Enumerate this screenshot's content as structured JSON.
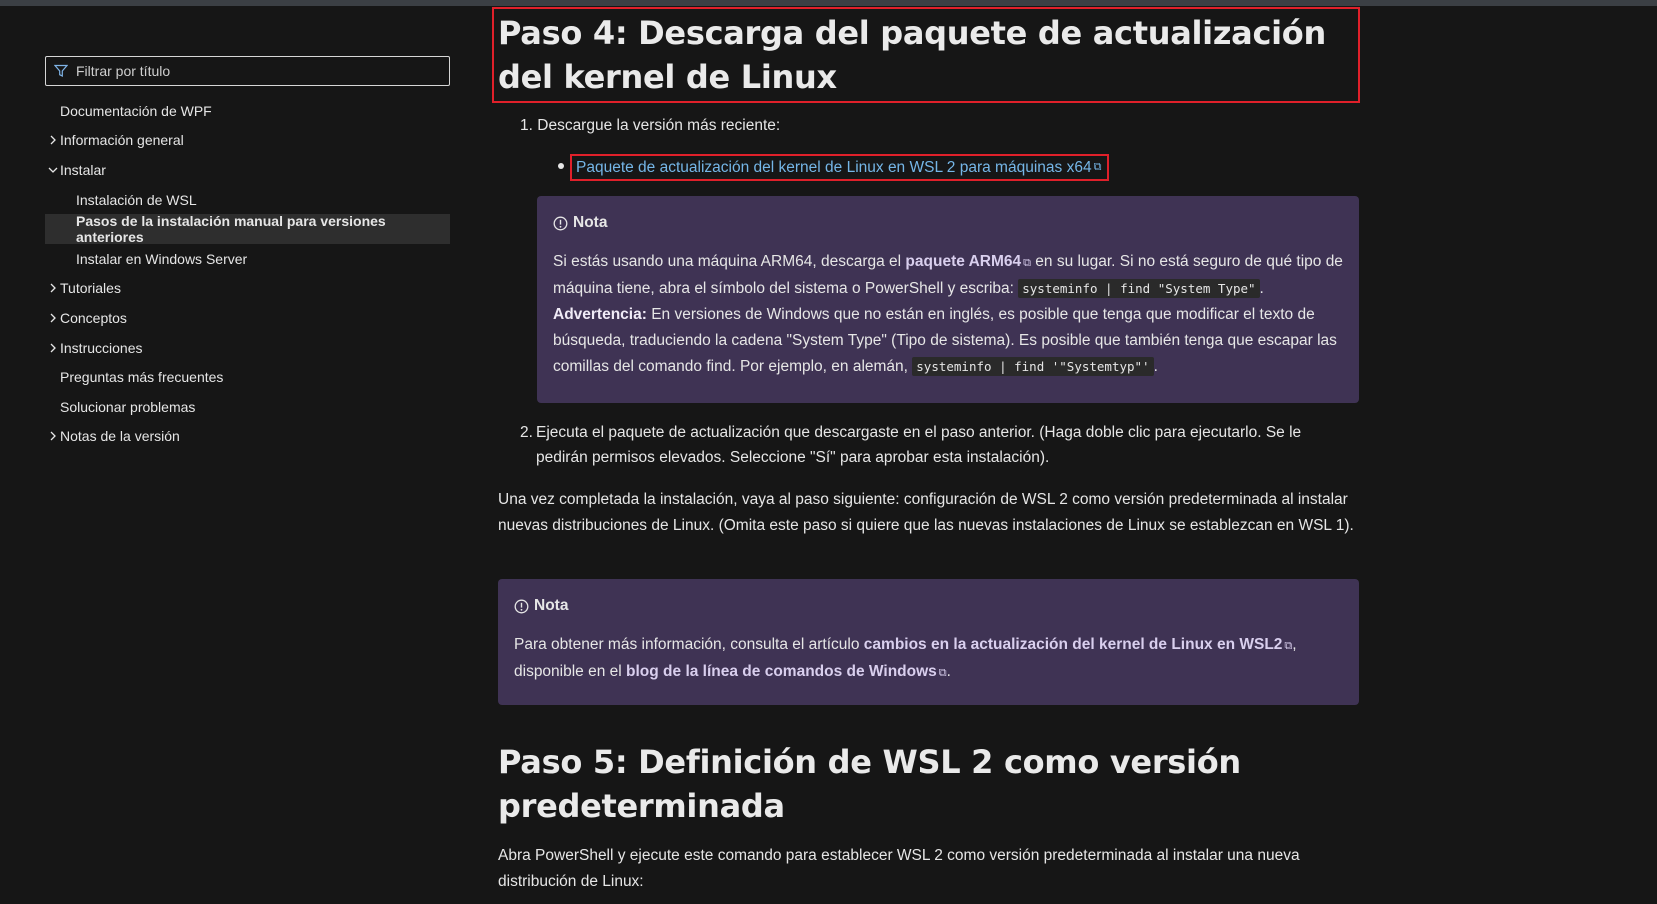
{
  "sidebar": {
    "filter_placeholder": "Filtrar por título",
    "items": [
      {
        "label": "Documentación de WPF"
      },
      {
        "label": "Información general"
      },
      {
        "label": "Instalar"
      },
      {
        "label": "Instalación de WSL"
      },
      {
        "label": "Pasos de la instalación manual para versiones anteriores"
      },
      {
        "label": "Instalar en Windows Server"
      },
      {
        "label": "Tutoriales"
      },
      {
        "label": "Conceptos"
      },
      {
        "label": "Instrucciones"
      },
      {
        "label": "Preguntas más frecuentes"
      },
      {
        "label": "Solucionar problemas"
      },
      {
        "label": "Notas de la versión"
      }
    ]
  },
  "main": {
    "step4_title": "Paso 4: Descarga del paquete de actualización del kernel de Linux",
    "step1_num": "1.",
    "step1_text": "Descargue la versión más reciente:",
    "download_link": "Paquete de actualización del kernel de Linux en WSL 2 para máquinas x64",
    "note1": {
      "heading": "Nota",
      "t1": "Si estás usando una máquina ARM64, descarga el ",
      "link_arm": "paquete ARM64",
      "t2": " en su lugar. Si no está seguro de qué tipo de máquina tiene, abra el símbolo del sistema o PowerShell y escriba: ",
      "code1": "systeminfo | find \"System Type\"",
      "t3": ".",
      "warn_label": "Advertencia:",
      "t4": " En versiones de Windows que no están en inglés, es posible que tenga que modificar el texto de búsqueda, traduciendo la cadena \"System Type\" (Tipo de sistema). Es posible que también tenga que escapar las comillas del comando find. Por ejemplo, en alemán, ",
      "code2": "systeminfo | find '\"Systemtyp\"'",
      "t5": "."
    },
    "step2_num": "2.",
    "step2_text": "Ejecuta el paquete de actualización que descargaste en el paso anterior. (Haga doble clic para ejecutarlo. Se le pedirán permisos elevados. Seleccione \"Sí\" para aprobar esta instalación).",
    "after_text": "Una vez completada la instalación, vaya al paso siguiente: configuración de WSL 2 como versión predeterminada al instalar nuevas distribuciones de Linux. (Omita este paso si quiere que las nuevas instalaciones de Linux se establezcan en WSL 1).",
    "note2": {
      "heading": "Nota",
      "t1": "Para obtener más información, consulta el artículo ",
      "link1": "cambios en la actualización del kernel de Linux en WSL2",
      "t2": ", disponible en el ",
      "link2": "blog de la línea de comandos de Windows",
      "t3": "."
    },
    "step5_title": "Paso 5: Definición de WSL 2 como versión predeterminada",
    "step5_text": "Abra PowerShell y ejecute este comando para establecer WSL 2 como versión predeterminada al instalar una nueva distribución de Linux:"
  }
}
